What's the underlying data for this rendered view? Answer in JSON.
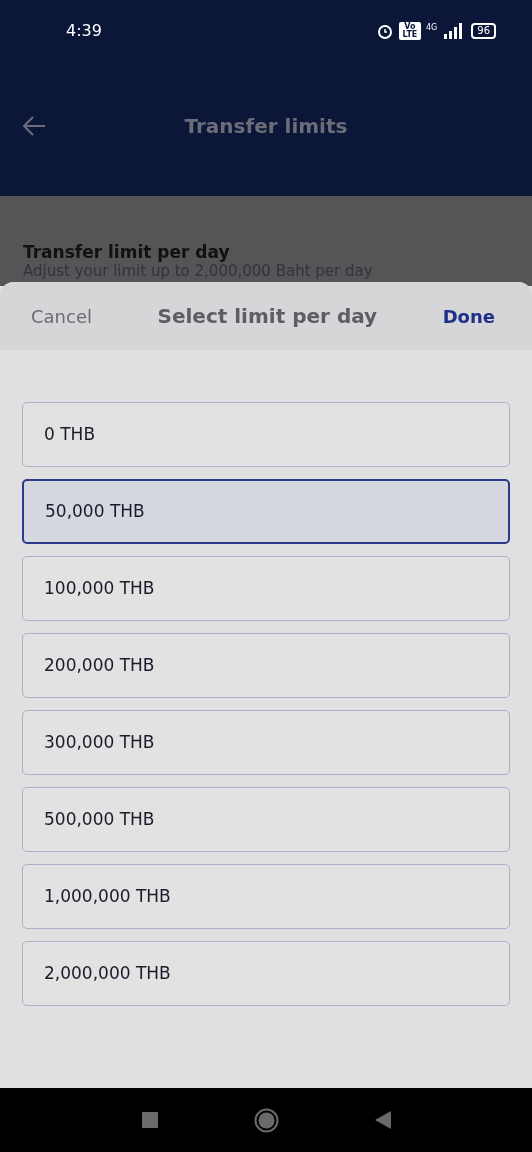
{
  "status_bar": {
    "time": "4:39",
    "volte": "Vo LTE",
    "network": "4G",
    "battery": "96"
  },
  "header": {
    "title": "Transfer limits"
  },
  "background_section": {
    "title": "Transfer limit per day",
    "subtitle": "Adjust your limit up to 2,000,000 Baht per day"
  },
  "sheet": {
    "cancel": "Cancel",
    "title": "Select limit per day",
    "done": "Done",
    "options": [
      {
        "label": "0 THB",
        "selected": false
      },
      {
        "label": "50,000 THB",
        "selected": true
      },
      {
        "label": "100,000 THB",
        "selected": false
      },
      {
        "label": "200,000 THB",
        "selected": false
      },
      {
        "label": "300,000 THB",
        "selected": false
      },
      {
        "label": "500,000 THB",
        "selected": false
      },
      {
        "label": "1,000,000 THB",
        "selected": false
      },
      {
        "label": "2,000,000 THB",
        "selected": false
      }
    ]
  }
}
